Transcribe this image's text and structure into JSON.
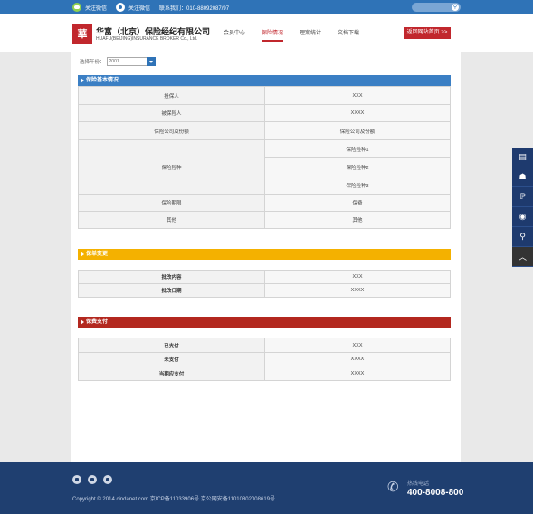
{
  "topbar": {
    "follow_wechat": "关注微信",
    "follow_weibo": "关注微信",
    "contact": "联系我们：010-88092087/97",
    "search_placeholder": ""
  },
  "header": {
    "logo_char": "華",
    "company_cn": "华富（北京）保险经纪有限公司",
    "company_en": "HUAFU(BEIJING)INSURANCE BROKER Co., Ltd.",
    "nav": [
      "会员中心",
      "保险情况",
      "理案统计",
      "文档下载"
    ],
    "nav_active_index": 1,
    "home_button": "返回网站首页 >>"
  },
  "filter": {
    "label": "选择年份：",
    "year": "2001"
  },
  "sections": {
    "basic": {
      "title": "保险基本情况",
      "rows": {
        "policyholder": {
          "label": "投保人",
          "value": "XXX"
        },
        "insured": {
          "label": "被保险人",
          "value": "XXXX"
        },
        "company": {
          "label": "保险公司及份额",
          "value": "保险公司及份额"
        },
        "types": {
          "label": "保险险种",
          "values": [
            "保险险种1",
            "保险险种2",
            "保险险种3"
          ]
        },
        "period": {
          "label": "保险期限",
          "value": "保费"
        },
        "other": {
          "label": "其他",
          "value": "其他"
        }
      }
    },
    "change": {
      "title": "保单变更",
      "rows": {
        "content": {
          "label": "批改内容",
          "value": "XXX"
        },
        "date": {
          "label": "批改日期",
          "value": "XXXX"
        }
      }
    },
    "payment": {
      "title": "保费支付",
      "rows": {
        "paid": {
          "label": "已支付",
          "value": "XXX"
        },
        "unpaid": {
          "label": "未支付",
          "value": "XXXX"
        },
        "due": {
          "label": "当期应支付",
          "value": "XXXX"
        }
      }
    }
  },
  "sidebar_icons": [
    "document-icon",
    "users-icon",
    "weibo-icon",
    "wechat-icon",
    "search-icon",
    "back-to-top-icon"
  ],
  "footer": {
    "copyright": "Copyright © 2014 cindanet.com 京ICP备11033906号 京公网安备110108020086​19号",
    "hotline_label": "热线电话",
    "hotline_number": "400-8008-800"
  },
  "colors": {
    "brand_blue": "#2f73b7",
    "brand_red": "#c1272d",
    "section_yellow": "#f4b100",
    "footer_navy": "#1f3f70"
  }
}
